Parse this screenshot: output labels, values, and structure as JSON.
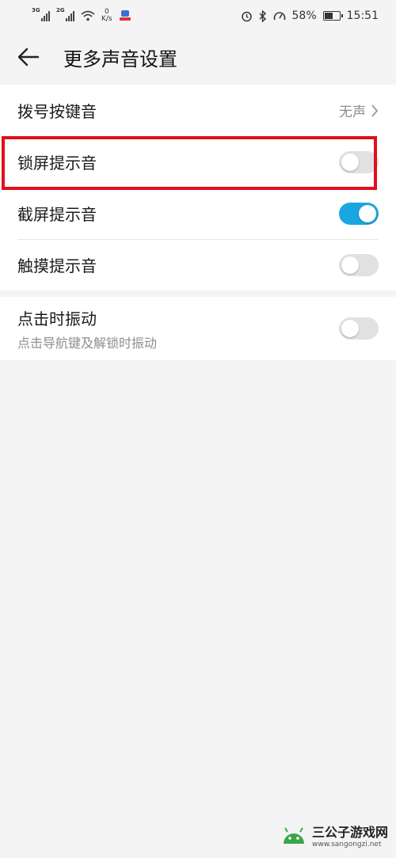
{
  "status_bar": {
    "net1": "3G",
    "net2": "2G",
    "speed_value": "0",
    "speed_unit": "K/s",
    "battery_pct": "58%",
    "battery_level": 0.58,
    "time": "15:51"
  },
  "header": {
    "title": "更多声音设置"
  },
  "group1": {
    "rows": [
      {
        "label": "拨号按键音",
        "value": "无声"
      },
      {
        "label": "锁屏提示音",
        "on": false
      },
      {
        "label": "截屏提示音",
        "on": true
      },
      {
        "label": "触摸提示音",
        "on": false
      }
    ]
  },
  "group2": {
    "rows": [
      {
        "label": "点击时振动",
        "sub": "点击导航键及解锁时振动",
        "on": false
      }
    ]
  },
  "watermark": {
    "title": "三公子游戏网",
    "url": "www.sangongzi.net"
  },
  "colors": {
    "accent": "#1aa7e0",
    "highlight": "#e0101a"
  }
}
